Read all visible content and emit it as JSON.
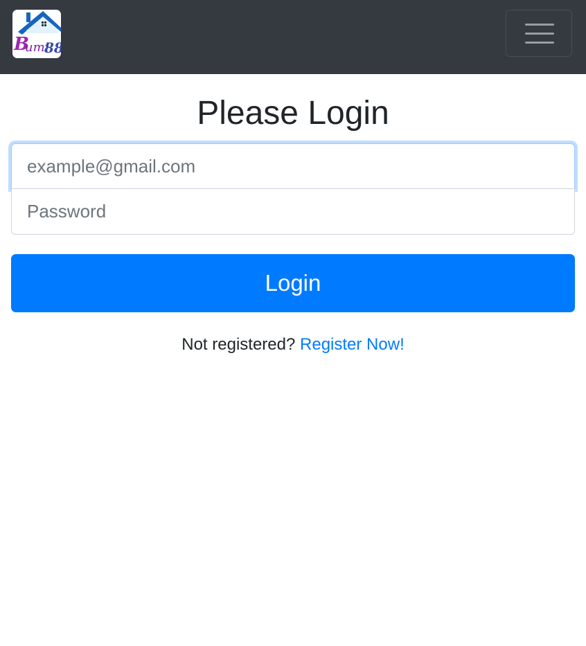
{
  "navbar": {
    "logo_text": "Bumi88",
    "logo_alt": "Bumi88 logo",
    "menu_toggle_label": "Toggle navigation"
  },
  "page": {
    "title": "Please Login"
  },
  "form": {
    "email_placeholder": "example@gmail.com",
    "email_value": "",
    "password_placeholder": "Password",
    "password_value": "",
    "login_label": "Login"
  },
  "register": {
    "prompt": "Not registered?",
    "link_label": "Register Now!"
  },
  "colors": {
    "navbar_bg": "#343a40",
    "primary": "#007bff",
    "text": "#212529",
    "placeholder": "#6c757d"
  },
  "icons": {
    "menu": "hamburger-icon",
    "logo": "house-logo"
  }
}
